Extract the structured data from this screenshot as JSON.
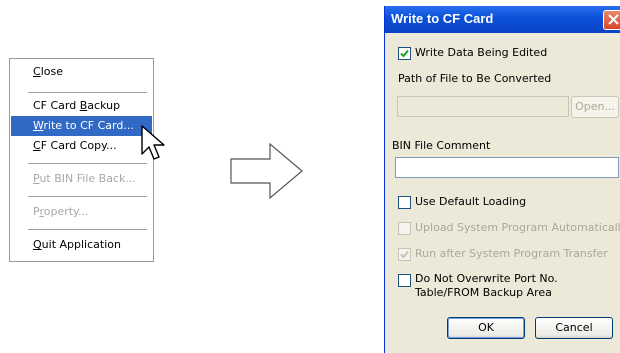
{
  "menu": {
    "items": [
      {
        "pre": "",
        "ul": "C",
        "post": "lose"
      },
      {
        "pre": "CF Card ",
        "ul": "B",
        "post": "ackup"
      },
      {
        "pre": "",
        "ul": "W",
        "post": "rite to CF Card..."
      },
      {
        "pre": "",
        "ul": "C",
        "post": "F Card Copy..."
      },
      {
        "pre": "",
        "ul": "P",
        "post": "ut BIN File Back..."
      },
      {
        "pre": "P",
        "ul": "r",
        "post": "operty..."
      },
      {
        "pre": "",
        "ul": "Q",
        "post": "uit Application"
      }
    ]
  },
  "dialog": {
    "title": "Write to CF Card",
    "write_data_label": "Write Data Being Edited",
    "path_label": "Path of File to Be Converted",
    "path_value": "",
    "open_button": "Open...",
    "comment_label": "BIN File Comment",
    "comment_value": "",
    "use_default_loading": "Use Default Loading",
    "upload_system_program": "Upload System Program Automatically",
    "run_after_transfer": "Run after System Program Transfer",
    "no_overwrite_line1": "Do Not Overwrite Port No.",
    "no_overwrite_line2": "Table/FROM Backup Area",
    "ok_button": "OK",
    "cancel_button": "Cancel"
  },
  "colors": {
    "selection": "#316ac5",
    "titlebar": "#0a4fd6",
    "dialog_bg": "#ece9d8"
  }
}
